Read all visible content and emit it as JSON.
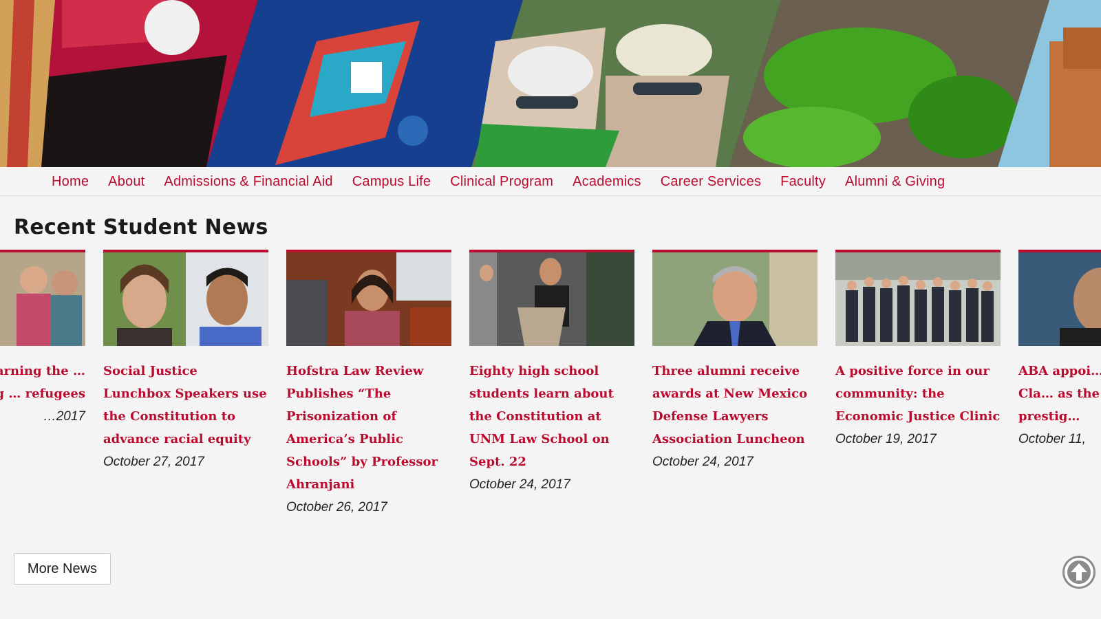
{
  "nav": {
    "items": [
      {
        "label": "Home"
      },
      {
        "label": "About"
      },
      {
        "label": "Admissions & Financial Aid"
      },
      {
        "label": "Campus Life"
      },
      {
        "label": "Clinical Program"
      },
      {
        "label": "Academics"
      },
      {
        "label": "Career Services"
      },
      {
        "label": "Faculty"
      },
      {
        "label": "Alumni & Giving"
      }
    ]
  },
  "news": {
    "title": "Recent Student News",
    "cards": [
      {
        "headline": "…ly …arning the … seeking … refugees",
        "date": "…2017"
      },
      {
        "headline": "Social Justice Lunchbox Speakers use the Constitution to advance racial equity",
        "date": "October 27, 2017"
      },
      {
        "headline": "Hofstra Law Review Publishes “The Prisonization of America’s Public Schools” by Professor Ahranjani",
        "date": "October 26, 2017"
      },
      {
        "headline": "Eighty high school students learn about the Constitution at UNM Law School on Sept. 22",
        "date": "October 24, 2017"
      },
      {
        "headline": "Three alumni receive awards at New Mexico Defense Lawyers Association Luncheon",
        "date": "October 24, 2017"
      },
      {
        "headline": "A positive force in our community: the Economic Justice Clinic",
        "date": "October 19, 2017"
      },
      {
        "headline": "ABA appoi… Dawdy, Cla… as the only… on prestig…",
        "date": "October 11,"
      }
    ],
    "more_label": "More News"
  },
  "colors": {
    "brand_red": "#ba0c2f",
    "background": "#f4f4f4"
  },
  "icons": {
    "scroll_top": "arrow-up-circle-icon"
  }
}
